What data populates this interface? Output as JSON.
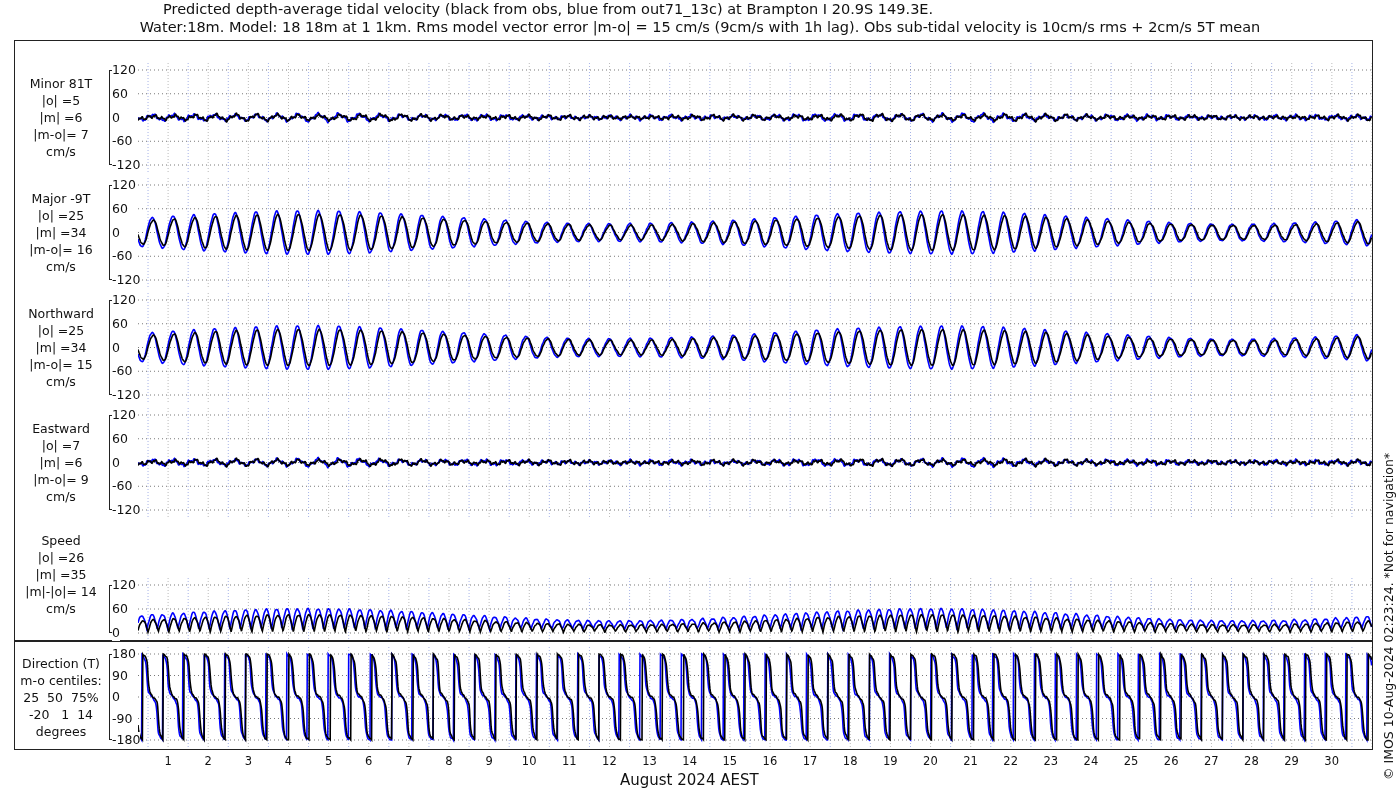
{
  "title": "Predicted depth-average tidal velocity (black from obs, blue from out71_13c) at Brampton I 20.9S 149.3E.",
  "subtitle": "Water:18m. Model: 18 18m at 1 1km. Rms model vector error |m-o| = 15 cm/s (9cm/s with 1h lag). Obs sub-tidal velocity is 10cm/s rms + 2cm/s 5T mean",
  "panels": [
    {
      "kind": "signed",
      "label_lines": [
        "Minor 81T",
        "|o| =5",
        "|m| =6",
        "|m-o|= 7",
        "cm/s"
      ],
      "yticks": [
        "120",
        "60",
        "0",
        "-60",
        "-120"
      ]
    },
    {
      "kind": "signed",
      "label_lines": [
        "Major -9T",
        "|o| =25",
        "|m| =34",
        "|m-o|= 16",
        "cm/s"
      ],
      "yticks": [
        "120",
        "60",
        "0",
        "-60",
        "-120"
      ]
    },
    {
      "kind": "signed",
      "label_lines": [
        "Northward",
        "|o| =25",
        "|m| =34",
        "|m-o|= 15",
        "cm/s"
      ],
      "yticks": [
        "120",
        "60",
        "0",
        "-60",
        "-120"
      ]
    },
    {
      "kind": "signed",
      "label_lines": [
        "Eastward",
        "|o| =7",
        "|m| =6",
        "|m-o|= 9",
        "cm/s"
      ],
      "yticks": [
        "120",
        "60",
        "0",
        "-60",
        "-120"
      ]
    },
    {
      "kind": "speed",
      "label_lines": [
        "Speed",
        "|o| =26",
        "|m| =35",
        "|m|-|o|= 14",
        "cm/s"
      ],
      "yticks": [
        "120",
        "60",
        "0"
      ]
    },
    {
      "kind": "direction",
      "label_lines": [
        "Direction (T)",
        "m-o centiles:",
        "25  50  75%",
        "-20   1  14",
        "degrees"
      ],
      "yticks": [
        "180",
        "90",
        "0",
        "-90",
        "-180"
      ]
    }
  ],
  "days": [
    "1",
    "2",
    "3",
    "4",
    "5",
    "6",
    "7",
    "8",
    "9",
    "10",
    "11",
    "12",
    "13",
    "14",
    "15",
    "16",
    "17",
    "18",
    "19",
    "20",
    "21",
    "22",
    "23",
    "24",
    "25",
    "26",
    "27",
    "28",
    "29",
    "30"
  ],
  "xlabel": "August 2024 AEST",
  "credit": "© IMOS 10-Aug-2024 02:23:24. *Not for navigation*"
}
